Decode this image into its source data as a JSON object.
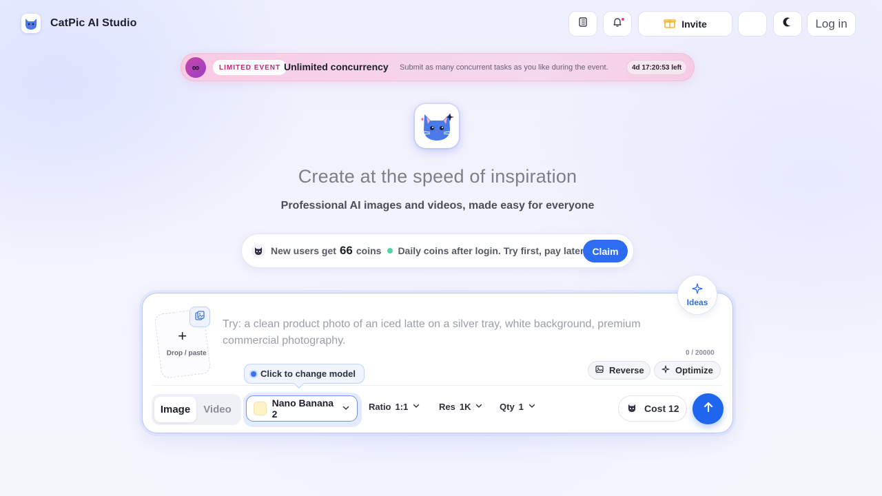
{
  "brand": {
    "name": "CatPic AI Studio"
  },
  "header": {
    "invite_label": "Invite",
    "login_label": "Log in"
  },
  "event": {
    "icon_glyph": "∞",
    "badge": "LIMITED EVENT",
    "title": "Unlimited concurrency",
    "description": "Submit as many concurrent tasks as you like during the event.",
    "timer": "4d 17:20:53 left"
  },
  "hero": {
    "title": "Create at the speed of inspiration",
    "subtitle": "Professional AI images and videos, made easy for everyone"
  },
  "promo": {
    "text_before": "New users get",
    "coins_number": "66",
    "text_after": "coins",
    "daily_text": "Daily coins after login. Try first, pay later.",
    "claim_label": "Claim"
  },
  "composer": {
    "dropzone_plus": "+",
    "dropzone_label": "Drop / paste",
    "prompt_placeholder": "Try: a clean product photo of an iced latte on a silver tray, white background, premium commercial photography.",
    "char_counter": "0 / 20000",
    "ideas_label": "Ideas",
    "reverse_label": "Reverse",
    "optimize_label": "Optimize",
    "tooltip_text": "Click to change model",
    "modes": [
      "Image",
      "Video"
    ],
    "active_mode": "Image",
    "model_name": "Nano Banana 2",
    "ratio_label": "Ratio",
    "ratio_value": "1:1",
    "res_label": "Res",
    "res_value": "1K",
    "qty_label": "Qty",
    "qty_value": "1",
    "cost_label": "Cost 12"
  },
  "colors": {
    "accent": "#2d6cf0",
    "event_pink": "#f8cbe3",
    "badge_text": "#c5236f",
    "coin_dot": "#4fd4a6"
  }
}
